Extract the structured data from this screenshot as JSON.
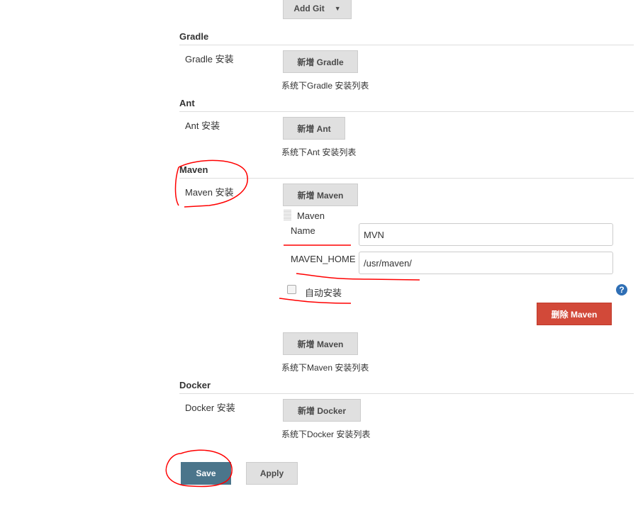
{
  "git": {
    "add_label": "Add Git"
  },
  "gradle": {
    "section": "Gradle",
    "label": "Gradle 安装",
    "add": "新增 Gradle",
    "hint": "系统下Gradle 安装列表"
  },
  "ant": {
    "section": "Ant",
    "label": "Ant 安装",
    "add": "新增 Ant",
    "hint": "系统下Ant 安装列表"
  },
  "maven": {
    "section": "Maven",
    "label": "Maven 安装",
    "add": "新增 Maven",
    "item_title": "Maven",
    "name_label": "Name",
    "name_value": "MVN",
    "home_label": "MAVEN_HOME",
    "home_value": "/usr/maven/",
    "auto_install": "自动安装",
    "auto_install_checked": false,
    "delete": "删除 Maven",
    "add2": "新增 Maven",
    "hint": "系统下Maven 安装列表"
  },
  "docker": {
    "section": "Docker",
    "label": "Docker 安装",
    "add": "新增 Docker",
    "hint": "系统下Docker 安装列表"
  },
  "footer": {
    "save": "Save",
    "apply": "Apply"
  },
  "colors": {
    "save": "#4b758b",
    "delete": "#d24939",
    "annotation": "#ff0000"
  }
}
